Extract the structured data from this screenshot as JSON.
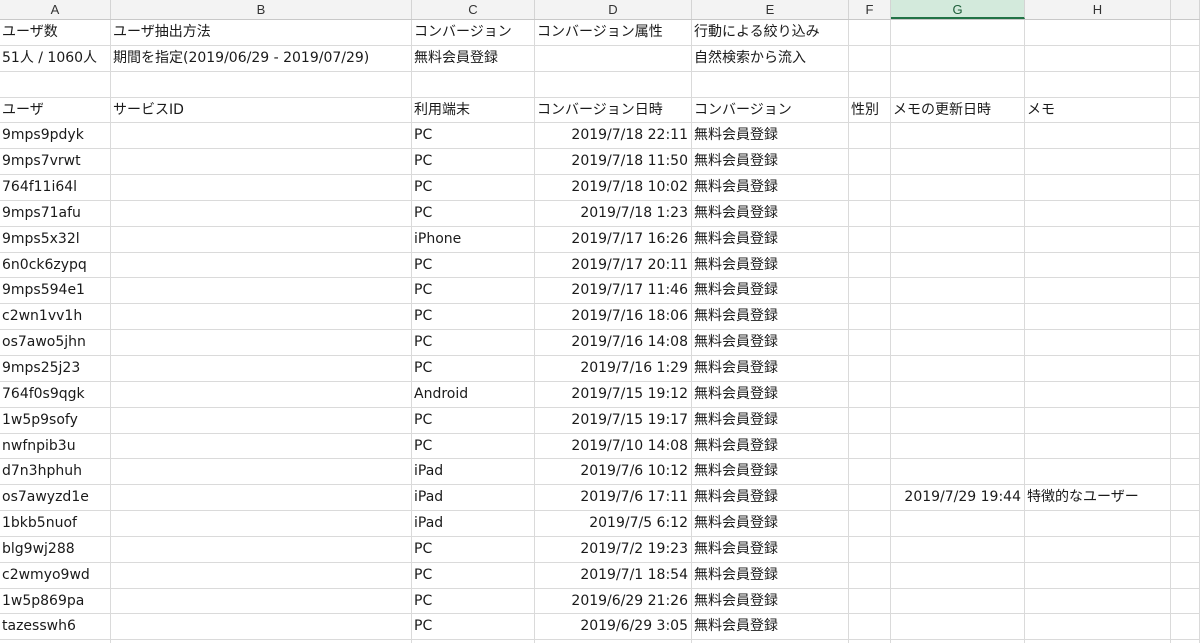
{
  "column_letters": [
    "A",
    "B",
    "C",
    "D",
    "E",
    "F",
    "G",
    "H",
    ""
  ],
  "summary_headers": [
    "ユーザ数",
    "ユーザ抽出方法",
    "コンバージョン",
    "コンバージョン属性",
    "行動による絞り込み",
    "",
    "",
    "",
    ""
  ],
  "summary_values": [
    "51人 / 1060人",
    "期間を指定(2019/06/29 - 2019/07/29)",
    "無料会員登録",
    "",
    "自然検索から流入",
    "",
    "",
    "",
    ""
  ],
  "blank_row": [
    "",
    "",
    "",
    "",
    "",
    "",
    "",
    "",
    ""
  ],
  "table_headers": [
    "ユーザ",
    "サービスID",
    "利用端末",
    "コンバージョン日時",
    "コンバージョン",
    "性別",
    "メモの更新日時",
    "メモ",
    ""
  ],
  "rows": [
    [
      "9mps9pdyk",
      "",
      "PC",
      "2019/7/18 22:11",
      "無料会員登録",
      "",
      "",
      "",
      ""
    ],
    [
      "9mps7vrwt",
      "",
      "PC",
      "2019/7/18 11:50",
      "無料会員登録",
      "",
      "",
      "",
      ""
    ],
    [
      "764f11i64l",
      "",
      "PC",
      "2019/7/18 10:02",
      "無料会員登録",
      "",
      "",
      "",
      ""
    ],
    [
      "9mps71afu",
      "",
      "PC",
      "2019/7/18 1:23",
      "無料会員登録",
      "",
      "",
      "",
      ""
    ],
    [
      "9mps5x32l",
      "",
      "iPhone",
      "2019/7/17 16:26",
      "無料会員登録",
      "",
      "",
      "",
      ""
    ],
    [
      "6n0ck6zypq",
      "",
      "PC",
      "2019/7/17 20:11",
      "無料会員登録",
      "",
      "",
      "",
      ""
    ],
    [
      "9mps594e1",
      "",
      "PC",
      "2019/7/17 11:46",
      "無料会員登録",
      "",
      "",
      "",
      ""
    ],
    [
      "c2wn1vv1h",
      "",
      "PC",
      "2019/7/16 18:06",
      "無料会員登録",
      "",
      "",
      "",
      ""
    ],
    [
      "os7awo5jhn",
      "",
      "PC",
      "2019/7/16 14:08",
      "無料会員登録",
      "",
      "",
      "",
      ""
    ],
    [
      "9mps25j23",
      "",
      "PC",
      "2019/7/16 1:29",
      "無料会員登録",
      "",
      "",
      "",
      ""
    ],
    [
      "764f0s9qgk",
      "",
      "Android",
      "2019/7/15 19:12",
      "無料会員登録",
      "",
      "",
      "",
      ""
    ],
    [
      "1w5p9sofy",
      "",
      "PC",
      "2019/7/15 19:17",
      "無料会員登録",
      "",
      "",
      "",
      ""
    ],
    [
      "nwfnpib3u",
      "",
      "PC",
      "2019/7/10 14:08",
      "無料会員登録",
      "",
      "",
      "",
      ""
    ],
    [
      "d7n3hphuh",
      "",
      "iPad",
      "2019/7/6 10:12",
      "無料会員登録",
      "",
      "",
      "",
      ""
    ],
    [
      "os7awyzd1e",
      "",
      "iPad",
      "2019/7/6 17:11",
      "無料会員登録",
      "",
      "2019/7/29 19:44",
      "特徴的なユーザー",
      ""
    ],
    [
      "1bkb5nuof",
      "",
      "iPad",
      "2019/7/5 6:12",
      "無料会員登録",
      "",
      "",
      "",
      ""
    ],
    [
      "blg9wj288",
      "",
      "PC",
      "2019/7/2 19:23",
      "無料会員登録",
      "",
      "",
      "",
      ""
    ],
    [
      "c2wmyo9wd",
      "",
      "PC",
      "2019/7/1 18:54",
      "無料会員登録",
      "",
      "",
      "",
      ""
    ],
    [
      "1w5p869pa",
      "",
      "PC",
      "2019/6/29 21:26",
      "無料会員登録",
      "",
      "",
      "",
      ""
    ],
    [
      "tazesswh6",
      "",
      "PC",
      "2019/6/29 3:05",
      "無料会員登録",
      "",
      "",
      "",
      ""
    ],
    [
      "",
      "",
      "",
      "",
      "",
      "",
      "",
      "",
      ""
    ]
  ]
}
